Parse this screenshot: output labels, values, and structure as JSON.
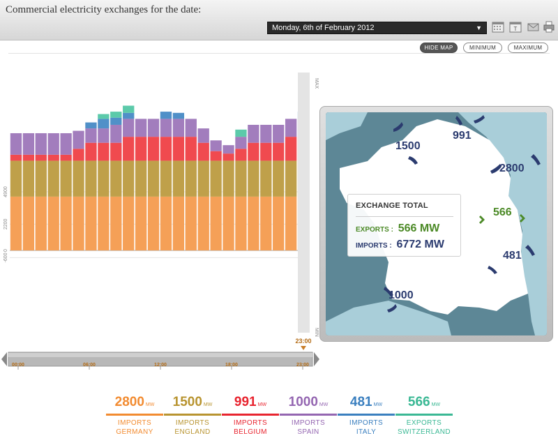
{
  "header": {
    "title": "Commercial electricity exchanges for the date:",
    "date_selected": "Monday, 6th of February 2012"
  },
  "toolbar": {
    "icons": [
      "calendar-icon",
      "calendar-today-icon",
      "email-icon",
      "print-icon"
    ]
  },
  "view_buttons": {
    "hide_map": "HIDE MAP",
    "minimum": "MINIMUM",
    "maximum": "MAXIMUM"
  },
  "chart_data": {
    "type": "bar",
    "stacked": true,
    "y_tick_labels": [
      "4900",
      "2200",
      "0",
      "-600"
    ],
    "y_markers": {
      "max": "MAX",
      "min": "MIN"
    },
    "x_tick_labels": [
      "00:00",
      "06:00",
      "12:00",
      "18:00",
      "23:00"
    ],
    "cursor_label": "23:00",
    "ylim": [
      -6872,
      14870
    ],
    "categories": [
      "00",
      "01",
      "02",
      "03",
      "04",
      "05",
      "06",
      "07",
      "08",
      "09",
      "10",
      "11",
      "12",
      "13",
      "14",
      "15",
      "16",
      "17",
      "18",
      "19",
      "20",
      "21",
      "22",
      "23"
    ],
    "series": [
      {
        "name": "GERMANY",
        "color": "#f5a057",
        "values": [
          4500,
          4500,
          4500,
          4500,
          4500,
          4500,
          4500,
          4500,
          4500,
          4500,
          4500,
          4500,
          4500,
          4500,
          4500,
          4500,
          4500,
          4500,
          4500,
          4500,
          4500,
          4500,
          4500,
          4500
        ]
      },
      {
        "name": "ENGLAND",
        "color": "#bfa04a",
        "values": [
          3000,
          3000,
          3000,
          3000,
          3000,
          3000,
          3000,
          3000,
          3000,
          3000,
          3000,
          3000,
          3000,
          3000,
          3000,
          3000,
          3000,
          3000,
          3000,
          3000,
          3000,
          3000,
          3000,
          3000
        ]
      },
      {
        "name": "BELGIUM",
        "color": "#f04a4f",
        "values": [
          500,
          500,
          500,
          500,
          500,
          1000,
          1500,
          1500,
          1500,
          2000,
          2000,
          2000,
          2000,
          2000,
          2000,
          1500,
          800,
          600,
          1000,
          1500,
          1500,
          1500,
          2000,
          2000
        ]
      },
      {
        "name": "SPAIN",
        "color": "#a27dbd",
        "values": [
          1800,
          1800,
          1800,
          1800,
          1800,
          1500,
          1200,
          1200,
          1500,
          1500,
          1500,
          1500,
          1500,
          1500,
          1500,
          1200,
          900,
          700,
          1000,
          1500,
          1500,
          1500,
          1500,
          1500
        ]
      },
      {
        "name": "ITALY",
        "color": "#5090c8",
        "values": [
          0,
          0,
          0,
          0,
          0,
          0,
          500,
          800,
          600,
          500,
          0,
          0,
          600,
          500,
          0,
          0,
          0,
          0,
          0,
          0,
          0,
          0,
          0,
          600
        ]
      },
      {
        "name": "SWITZERLAND",
        "color": "#5ccaaa",
        "values": [
          0,
          0,
          0,
          0,
          0,
          0,
          0,
          400,
          500,
          600,
          0,
          0,
          0,
          0,
          0,
          0,
          0,
          0,
          600,
          0,
          0,
          0,
          0,
          0
        ]
      }
    ]
  },
  "map": {
    "flows": [
      "1500",
      "991",
      "2800",
      "566",
      "481",
      "1000"
    ],
    "exchange_total": {
      "title": "EXCHANGE TOTAL",
      "exports_label": "EXPORTS :",
      "exports_value": "566 MW",
      "imports_label": "IMPORTS :",
      "imports_value": "6772 MW"
    }
  },
  "legend": [
    {
      "value": "2800",
      "unit": "MW",
      "label1": "IMPORTS",
      "label2": "GERMANY",
      "color": "#f28b30"
    },
    {
      "value": "1500",
      "unit": "MW",
      "label1": "IMPORTS",
      "label2": "ENGLAND",
      "color": "#b89430"
    },
    {
      "value": "991",
      "unit": "MW",
      "label1": "IMPORTS",
      "label2": "BELGIUM",
      "color": "#e8242f"
    },
    {
      "value": "1000",
      "unit": "MW",
      "label1": "IMPORTS",
      "label2": "SPAIN",
      "color": "#9466b1"
    },
    {
      "value": "481",
      "unit": "MW",
      "label1": "IMPORTS",
      "label2": "ITALY",
      "color": "#3a7fbf"
    },
    {
      "value": "566",
      "unit": "MW",
      "label1": "EXPORTS",
      "label2": "SWITZERLAND",
      "color": "#3ab894"
    }
  ]
}
